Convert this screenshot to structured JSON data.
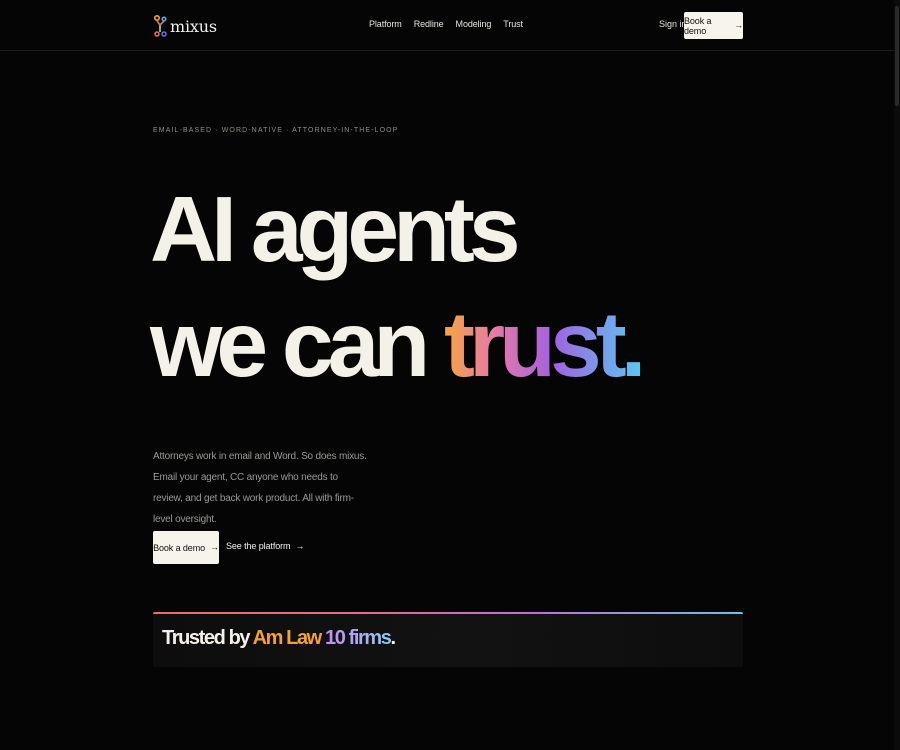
{
  "brand": {
    "name": "mixus",
    "logo_icon": "mixus-logo-icon",
    "colors": {
      "background": "#050505",
      "text": "#f3f1ea",
      "gradient_orange": "#f4a640",
      "gradient_pink": "#e87aa6",
      "gradient_purple": "#a262e0",
      "gradient_cyan": "#5bc8f0"
    }
  },
  "nav": {
    "items": [
      "Platform",
      "Redline",
      "Modeling",
      "Trust"
    ]
  },
  "header": {
    "sign_in": "Sign in",
    "book_demo": "Book a demo",
    "arrow": "→"
  },
  "hero": {
    "eyebrow": "EMAIL-BASED · WORD-NATIVE · ATTORNEY-IN-THE-LOOP",
    "headline_line1": "AI agents",
    "headline_line2_prefix": "we can ",
    "headline_highlight": "trust.",
    "lead": "Attorneys work in email and Word. So does mixus. Email your agent, CC anyone who needs to review, and get back work product. All with firm-level oversight.",
    "primary_cta": "Book a demo",
    "secondary_cta": "See the platform",
    "arrow": "→"
  },
  "trusted": {
    "prefix": "Trusted by ",
    "highlight_a": "Am Law",
    "highlight_b": "10 firms",
    "suffix": "."
  }
}
